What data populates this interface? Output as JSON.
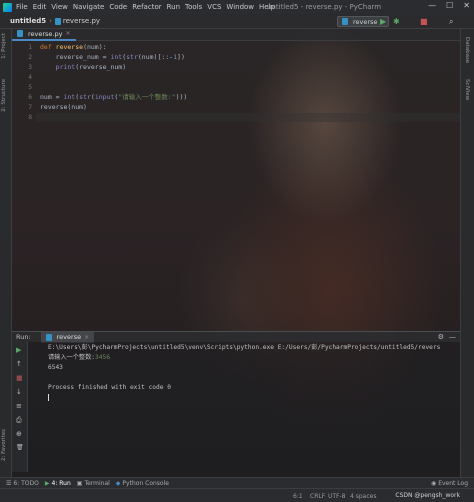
{
  "menu": [
    "File",
    "Edit",
    "View",
    "Navigate",
    "Code",
    "Refactor",
    "Run",
    "Tools",
    "VCS",
    "Window",
    "Help"
  ],
  "window_title": "untitled5 - reverse.py - PyCharm",
  "window_controls": {
    "minimize": "—",
    "maximize": "☐",
    "close": "✕"
  },
  "breadcrumb": {
    "project": "untitled5",
    "file": "reverse.py"
  },
  "run_config": {
    "label": "reverse",
    "dropdown": "▾"
  },
  "toolbar_icons": {
    "run": "▶",
    "debug": "✱",
    "stop": "■",
    "search": "⌕"
  },
  "left_tabs": {
    "project": "1: Project",
    "structure": "2: Structure",
    "favorites": "2: Favorites"
  },
  "right_tabs": {
    "database": "Database",
    "sciview": "SciView"
  },
  "editor_tab": {
    "label": "reverse.py",
    "close": "×"
  },
  "line_numbers": [
    "1",
    "2",
    "3",
    "4",
    "5",
    "6",
    "7",
    "8"
  ],
  "code": {
    "l1_kw": "def ",
    "l1_fn": "reverse",
    "l1_rest": "(num):",
    "l2_a": "    reverse_num = ",
    "l2_b": "int",
    "l2_c": "(",
    "l2_d": "str",
    "l2_e": "(num)[::-",
    "l2_f": "1",
    "l2_g": "])",
    "l3_a": "    ",
    "l3_b": "print",
    "l3_c": "(reverse_num)",
    "l6_a": "num = ",
    "l6_b": "int",
    "l6_c": "(",
    "l6_d": "str",
    "l6_e": "(",
    "l6_f": "input",
    "l6_g": "(",
    "l6_h": "\"请输入一个整数:\"",
    "l6_i": ")))",
    "l7": "reverse(num)"
  },
  "run_panel": {
    "label": "Run:",
    "tab": "reverse",
    "tab_close": "×",
    "settings_icon": "⚙",
    "minimize_icon": "—"
  },
  "run_tool_icons": {
    "rerun": "▶",
    "up": "↑",
    "stop": "■",
    "down": "↓",
    "wrap": "≡",
    "print": "⎙",
    "pin": "⊕",
    "delete": "🗑"
  },
  "console": {
    "cmd": "E:\\Users\\彭\\PycharmProjects\\untitled5\\venv\\Scripts\\python.exe E:/Users/彭/PycharmProjects/untitled5/revers",
    "prompt": "请输入一个整数:",
    "input_value": "3456",
    "output": "6543",
    "finished": "Process finished with exit code 0"
  },
  "bottom_tools": {
    "todo": "6: TODO",
    "run": "4: Run",
    "terminal": "Terminal",
    "python_console": "Python Console",
    "event_log": "Event Log"
  },
  "status": {
    "position": "6:1",
    "line_sep": "CRLF",
    "encoding": "UTF-8",
    "indent": "4 spaces",
    "watermark": "CSDN @pengsh_work"
  }
}
